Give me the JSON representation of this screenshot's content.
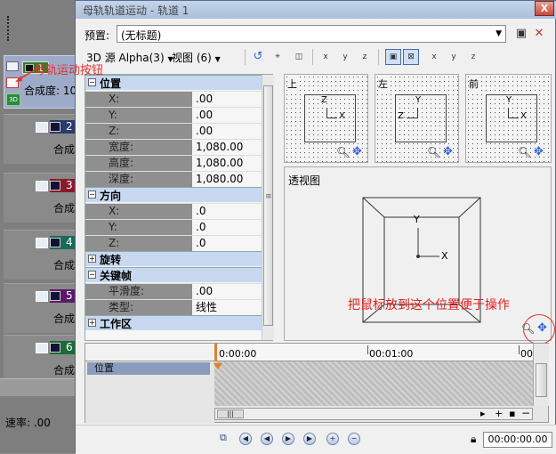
{
  "window": {
    "title": "母轨轨道运动 - 轨道 1",
    "close_label": "X"
  },
  "left_panel": {
    "track1_label": "合成度: 10",
    "track1_number": "1",
    "tracks": [
      {
        "number": "2",
        "label": "合成",
        "color": "#2a3a6a"
      },
      {
        "number": "3",
        "label": "合成",
        "color": "#8a1a2a"
      },
      {
        "number": "4",
        "label": "合成",
        "color": "#1a6a5a"
      },
      {
        "number": "5",
        "label": "合成",
        "color": "#5a1a6a"
      },
      {
        "number": "6",
        "label": "合成",
        "color": "#1a6a3a"
      }
    ],
    "speed": "速率: .00"
  },
  "annotations": {
    "track_button": "母轨运动按钮",
    "mouse_position": "把鼠标放到这个位置便于操作",
    "color": "#e03030"
  },
  "preset": {
    "label": "预置:",
    "value": "(无标题)"
  },
  "toolbar": {
    "source": "3D 源 Alpha(3)",
    "view": "视图 (6)"
  },
  "properties": {
    "groups": [
      {
        "name": "位置",
        "expanded": true,
        "rows": [
          {
            "key": "X:",
            "value": ".00"
          },
          {
            "key": "Y:",
            "value": ".00"
          },
          {
            "key": "Z:",
            "value": ".00"
          },
          {
            "key": "宽度:",
            "value": "1,080.00"
          },
          {
            "key": "高度:",
            "value": "1,080.00"
          },
          {
            "key": "深度:",
            "value": "1,080.00"
          }
        ]
      },
      {
        "name": "方向",
        "expanded": true,
        "rows": [
          {
            "key": "X:",
            "value": ".0"
          },
          {
            "key": "Y:",
            "value": ".0"
          },
          {
            "key": "Z:",
            "value": ".0"
          }
        ]
      },
      {
        "name": "旋转",
        "expanded": false,
        "rows": []
      },
      {
        "name": "关键帧",
        "expanded": true,
        "rows": [
          {
            "key": "平滑度:",
            "value": ".00"
          },
          {
            "key": "类型:",
            "value": "线性"
          }
        ]
      },
      {
        "name": "工作区",
        "expanded": false,
        "rows": []
      }
    ]
  },
  "views": {
    "top": {
      "label": "上",
      "axis_a": "Z",
      "axis_b": "X"
    },
    "left": {
      "label": "左",
      "axis_a": "Y",
      "axis_b": "Z"
    },
    "front": {
      "label": "前",
      "axis_a": "Y",
      "axis_b": "X"
    },
    "perspective": {
      "label": "透视图",
      "axis_a": "Y",
      "axis_b": "X"
    }
  },
  "timeline": {
    "track_label": "位置",
    "ruler": [
      "0:00:00",
      "00:01:00",
      "00"
    ],
    "timecode": "00:00:00.00"
  }
}
